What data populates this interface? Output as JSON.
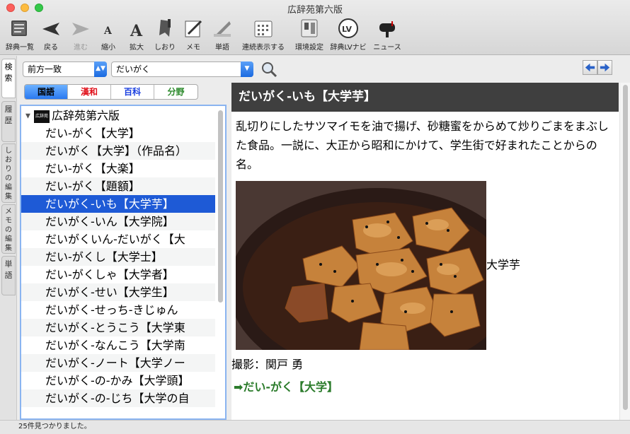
{
  "window": {
    "title": "広辞苑第六版"
  },
  "toolbar": {
    "items": [
      {
        "label": "辞典一覧",
        "icon": "dictionary-list-icon"
      },
      {
        "label": "戻る",
        "icon": "back-arrow-icon"
      },
      {
        "label": "進む",
        "icon": "forward-arrow-icon"
      },
      {
        "label": "縮小",
        "icon": "shrink-text-icon"
      },
      {
        "label": "拡大",
        "icon": "enlarge-text-icon"
      },
      {
        "label": "しおり",
        "icon": "bookmark-icon"
      },
      {
        "label": "メモ",
        "icon": "memo-icon"
      },
      {
        "label": "単語",
        "icon": "word-icon"
      },
      {
        "label": "連続表示する",
        "icon": "continuous-display-icon"
      },
      {
        "label": "環境設定",
        "icon": "preferences-icon"
      },
      {
        "label": "辞典LVナビ",
        "icon": "lv-navi-icon"
      },
      {
        "label": "ニュース",
        "icon": "news-mailbox-icon"
      }
    ]
  },
  "side_tabs": [
    {
      "label": "検索"
    },
    {
      "label": "履歴"
    },
    {
      "label": "しおりの編集"
    },
    {
      "label": "メモの編集"
    },
    {
      "label": "単語"
    }
  ],
  "search": {
    "mode": "前方一致",
    "query": "だいがく"
  },
  "segments": [
    {
      "label": "国語",
      "color": "#000000"
    },
    {
      "label": "漢和",
      "color": "#e0101a"
    },
    {
      "label": "百科",
      "color": "#1a3fe0"
    },
    {
      "label": "分野",
      "color": "#2c8a2c"
    }
  ],
  "word_list": {
    "root": "広辞苑第六版",
    "root_logo": "広辞苑",
    "items": [
      "だい-がく【大学】",
      "だいがく【大学】（作品名）",
      "だい-がく【大楽】",
      "だい-がく【題額】",
      "だいがく-いも【大学芋】",
      "だいがく-いん【大学院】",
      "だいがくいん-だいがく【大",
      "だい-がくし【大学士】",
      "だい-がくしゃ【大学者】",
      "だいがく-せい【大学生】",
      "だいがく-せっち-きじゅん",
      "だいがく-とうこう【大学東",
      "だいがく-なんこう【大学南",
      "だいがく-ノート【大学ノー",
      "だいがく-の-かみ【大学頭】",
      "だいがく-の-じち【大学の自"
    ],
    "selected_index": 4
  },
  "entry": {
    "headword": "だいがく-いも【大学芋】",
    "definition": "乱切りにしたサツマイモを油で揚げ、砂糖蜜をからめて炒りごまをまぶした食品。一説に、大正から昭和にかけて、学生街で好まれたことからの名。",
    "image_caption": "大学芋",
    "credit": "撮影：関戸 勇",
    "cross_ref": "➡だい-がく【大学】"
  },
  "status": {
    "text": "25件見つかりました。"
  }
}
